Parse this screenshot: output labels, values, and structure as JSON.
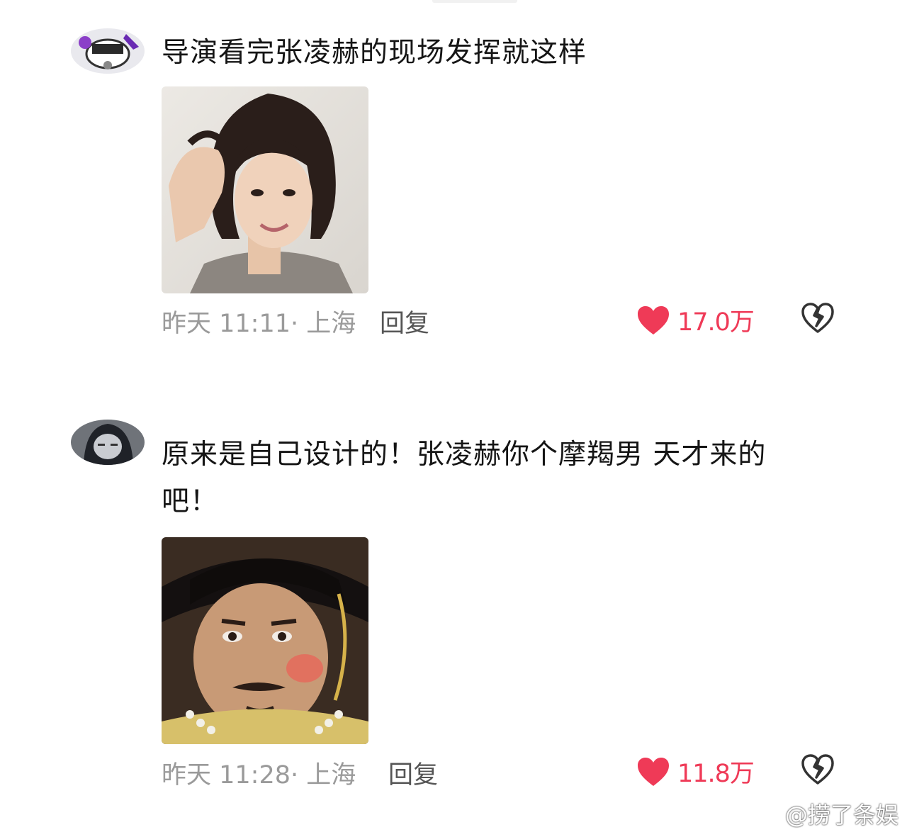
{
  "comments": [
    {
      "text": "导演看完张凌赫的现场发挥就这样",
      "time": "昨天 11:11· 上海",
      "reply_label": "回复",
      "likes": "17.0万",
      "avatar_icon": "anime-avatar-icon",
      "image_icon": "short-hair-woman-photo"
    },
    {
      "text": "原来是自己设计的！张凌赫你个摩羯男 天才来的吧！",
      "time": "昨天 11:28· 上海",
      "reply_label": "回复",
      "likes": "11.8万",
      "avatar_icon": "dark-hair-avatar-icon",
      "image_icon": "qing-official-photo"
    }
  ],
  "watermark": {
    "text": "@捞了条娱",
    "icon": "weibo-icon"
  },
  "colors": {
    "like": "#ef3a57",
    "meta": "#9a9a9a",
    "reply": "#555555",
    "text": "#151515"
  }
}
